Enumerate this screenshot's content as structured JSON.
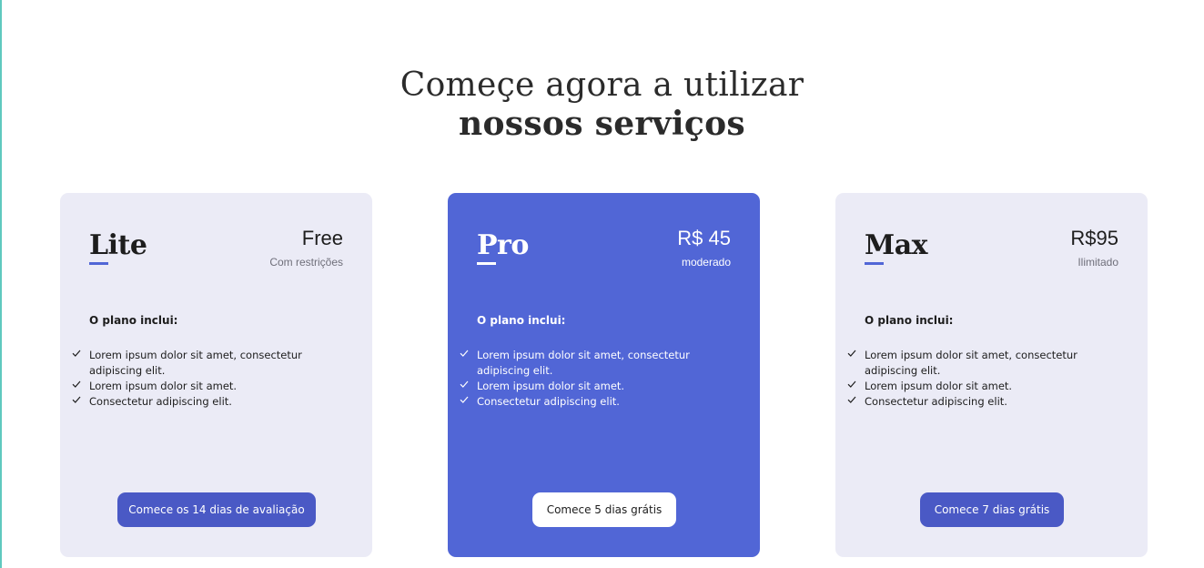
{
  "heading": {
    "line1": "Começe agora a utilizar",
    "line2": "nossos serviços"
  },
  "plans": [
    {
      "name": "Lite",
      "price": "Free",
      "price_note": "Com restrições",
      "includes_label": "O plano inclui:",
      "features": [
        "Lorem ipsum dolor sit amet, consectetur adipiscing elit.",
        "Lorem ipsum dolor sit amet.",
        "Consectetur adipiscing elit."
      ],
      "cta_label": "Comece os 14 dias de avaliação"
    },
    {
      "name": "Pro",
      "price": "R$ 45",
      "price_note": "moderado",
      "includes_label": "O plano inclui:",
      "features": [
        "Lorem ipsum dolor sit amet, consectetur adipiscing elit.",
        "Lorem ipsum dolor sit amet.",
        "Consectetur adipiscing elit."
      ],
      "cta_label": "Comece 5 dias grátis"
    },
    {
      "name": "Max",
      "price": "R$95",
      "price_note": "Ilimitado",
      "includes_label": "O plano inclui:",
      "features": [
        "Lorem ipsum dolor sit amet, consectetur adipiscing elit.",
        "Lorem ipsum dolor sit amet.",
        "Consectetur adipiscing elit."
      ],
      "cta_label": "Comece 7 dias grátis"
    }
  ],
  "colors": {
    "accent": "#5166d6",
    "button": "#4a59c5",
    "card_background": "#ebebf6",
    "edge_line": "#5fc9bf"
  },
  "icons": {
    "feature_bullet": "check-icon"
  }
}
